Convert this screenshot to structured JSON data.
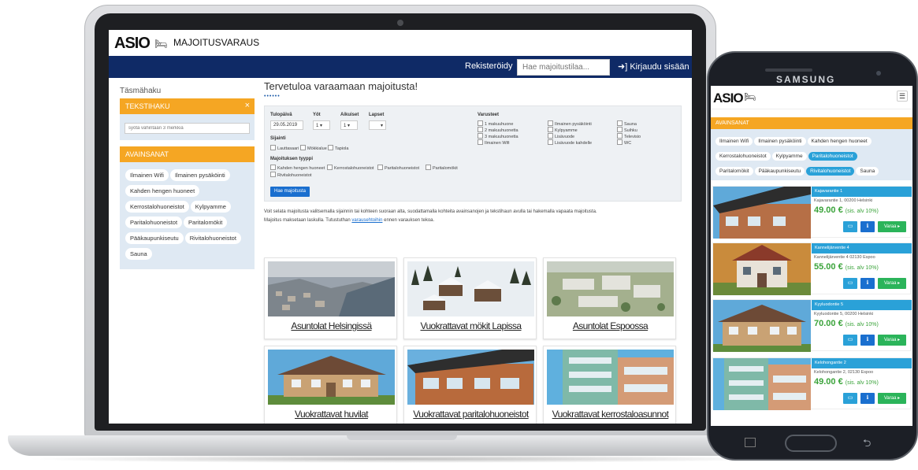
{
  "brand": {
    "logo": "ASIO",
    "bed_icon": "bed-icon",
    "subtitle": "MAJOITUSVARAUS"
  },
  "nav": {
    "register": "Rekisteröidy",
    "search_placeholder": "Hae majoitustilaa...",
    "login": "Kirjaudu sisään"
  },
  "sidebar": {
    "title": "Täsmähaku",
    "text_search": {
      "header": "TEKSTIHAKU",
      "close": "×",
      "placeholder": "syötä vähintään 3 merkkiä"
    },
    "keywords": {
      "header": "AVAINSANAT",
      "chips": [
        "Ilmainen Wifi",
        "Ilmainen pysäköinti",
        "Kahden hengen huoneet",
        "Kerrostalohuoneistot",
        "Kylpyamme",
        "Paritalohuoneistot",
        "Paritalomökit",
        "Pääkaupunkiseutu",
        "Rivitalohuoneistot",
        "Sauna"
      ]
    }
  },
  "main": {
    "welcome": "Tervetuloa varaamaan majoitusta!",
    "dots": "••••••",
    "form": {
      "arrival_label": "Tulopäivä",
      "arrival_value": "29.05.2019",
      "nights_label": "Yöt",
      "nights_value": "1",
      "adults_label": "Aikuiset",
      "adults_value": "1",
      "children_label": "Lapset",
      "children_value": "",
      "location_label": "Sijainti",
      "locations": [
        "Lauttasaari",
        "Mökkialue",
        "Tapiola"
      ],
      "type_label": "Majoituksen tyyppi",
      "types": [
        "Kahden hengen huoneet",
        "Kerrostalohuoneistot",
        "Paritalohuoneistot",
        "Paritalomökit",
        "Rivitalohuoneistot"
      ],
      "equipment_label": "Varusteet",
      "equipment": [
        "1 makuuhuone",
        "2 makuuhuonetta",
        "3 makuuhuonetta",
        "Ilmainen Wifi",
        "Ilmainen pysäköinti",
        "Kylpyamme",
        "Lisävuode",
        "Lisävuode kahdelle",
        "Sauna",
        "Suihku",
        "Televisio",
        "WC"
      ],
      "search_button": "Hae majoitusta"
    },
    "intro_1": "Voit selata majoitusta valitsemalla sijainnin tai kohteen suoraan alta, suodattamalla kohteita avainsanojen ja tekstihaun avulla tai hakemalla vapaata majoitusta.",
    "intro_2a": "Majoitus maksetaan laskulla. Tutustuthan",
    "intro_link": "varausehtoihin",
    "intro_2b": "ennen varauksen tekoa.",
    "cards": [
      "Asuntolat Helsingissä",
      "Vuokrattavat mökit Lapissa",
      "Asuntolat Espoossa",
      "Vuokrattavat huvilat",
      "Vuokrattavat paritalohuoneistot",
      "Vuokrattavat kerrostaloasunnot"
    ]
  },
  "phone": {
    "brand": "SAMSUNG",
    "menu_icon": "hamburger-icon",
    "keywords_header": "AVAINSANAT",
    "chips": [
      "Ilmainen Wifi",
      "Ilmainen pysäköinti",
      "Kahden hengen huoneet",
      "Kerrostalohuoneistot",
      "Kylpyamme",
      "Paritalohuoneistot",
      "Paritalomökit",
      "Pääkaupunkiseutu",
      "Rivitalohuoneistot",
      "Sauna"
    ],
    "selected_chips": [
      "Paritalohuoneistot",
      "Rivitalohuoneistot"
    ],
    "listings": [
      {
        "title": "Kajavarantie 1",
        "address": "Kajavarantie 1, 00200 Helsinki",
        "price": "49.00 €",
        "vat": "(sis. alv 10%)",
        "book": "Varaa ▸"
      },
      {
        "title": "Kannelijärventie 4",
        "address": "Kannelijärventie 4 02130 Espoo",
        "price": "55.00 €",
        "vat": "(sis. alv 10%)",
        "book": "Varaa ▸"
      },
      {
        "title": "Kyyluodontie 5",
        "address": "Kyyluodontie 5, 00200 Helsinki",
        "price": "70.00 €",
        "vat": "(sis. alv 10%)",
        "book": "Varaa ▸"
      },
      {
        "title": "Kelohongantie 2",
        "address": "Kelohongantie 2, 02130 Espoo",
        "price": "49.00 €",
        "vat": "(sis. alv 10%)",
        "book": "Varaa ▸"
      }
    ]
  }
}
